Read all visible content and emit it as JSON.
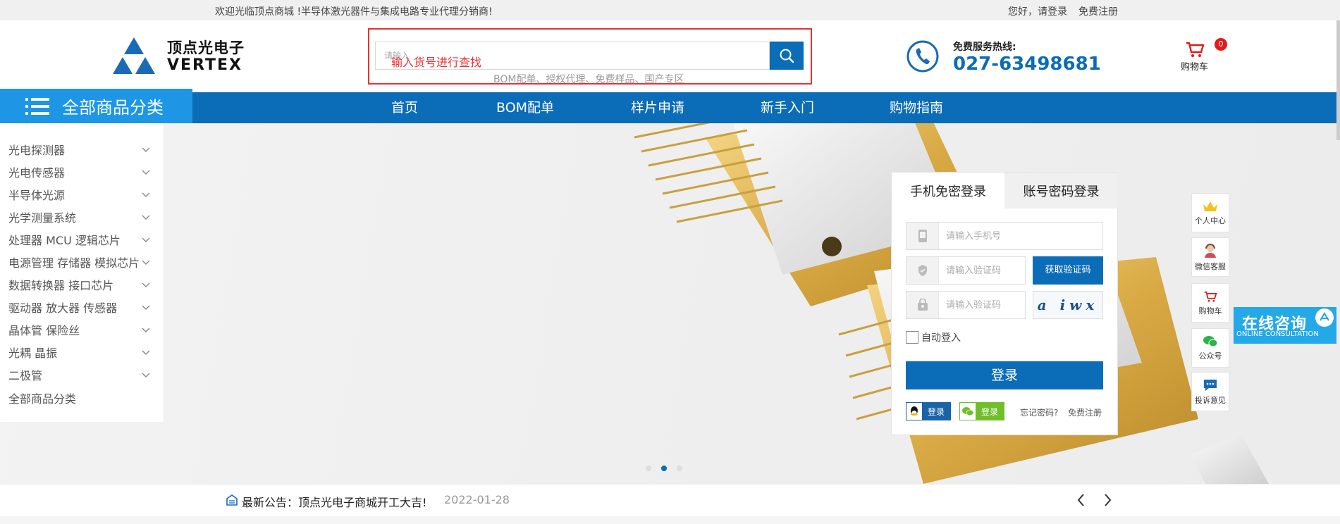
{
  "topbar": {
    "welcome": "欢迎光临顶点商城 !半导体激光器件与集成电路专业代理分销商!",
    "login_prompt": "您好，请登录",
    "register": "免费注册"
  },
  "brand": {
    "name_cn": "顶点光电子",
    "name_en": "VERTEX",
    "color": "#1a6bb5"
  },
  "search": {
    "placeholder": "请输入",
    "hint": "输入货号进行查找",
    "button_icon": "search-icon",
    "hot_links": "BOM配单、授权代理、免费样品、国产专区"
  },
  "hotline": {
    "label": "免费服务热线:",
    "number": "027-63498681"
  },
  "cart": {
    "label": "购物车",
    "count": "0"
  },
  "nav": {
    "all_categories": "全部商品分类",
    "items": [
      {
        "label": "首页"
      },
      {
        "label": "BOM配单"
      },
      {
        "label": "样片申请"
      },
      {
        "label": "新手入门"
      },
      {
        "label": "购物指南"
      }
    ]
  },
  "categories": [
    {
      "label": "光电探测器"
    },
    {
      "label": "光电传感器"
    },
    {
      "label": "半导体光源"
    },
    {
      "label": "光学测量系统"
    },
    {
      "label": "处理器 MCU 逻辑芯片"
    },
    {
      "label": "电源管理 存储器 模拟芯片"
    },
    {
      "label": "数据转换器 接口芯片"
    },
    {
      "label": "驱动器 放大器 传感器"
    },
    {
      "label": "晶体管 保险丝"
    },
    {
      "label": "光耦 晶振"
    },
    {
      "label": "二极管"
    },
    {
      "label": "全部商品分类"
    }
  ],
  "login": {
    "tab_phone": "手机免密登录",
    "tab_password": "账号密码登录",
    "phone_placeholder": "请输入手机号",
    "code_placeholder": "请输入验证码",
    "captcha_placeholder": "请输入验证码",
    "get_code": "获取验证码",
    "captcha_text": "a iwx",
    "auto_login": "自动登入",
    "submit": "登录",
    "qq_label": "登录",
    "wechat_label": "登录",
    "forgot": "忘记密码?",
    "register": "免费注册"
  },
  "carousel": {
    "slides": 3,
    "active": 2
  },
  "tools": [
    {
      "label": "个人中心",
      "icon": "crown-icon"
    },
    {
      "label": "微信客服",
      "icon": "service-agent-icon"
    },
    {
      "label": "购物车",
      "icon": "cart-icon"
    },
    {
      "label": "公众号",
      "icon": "wechat-icon"
    },
    {
      "label": "投诉意见",
      "icon": "feedback-icon"
    }
  ],
  "consult": {
    "title": "在线咨询",
    "subtitle": "ONLINE CONSULTATION"
  },
  "notice": {
    "text": "最新公告：顶点光电子商城开工大吉!",
    "date": "2022-01-28"
  }
}
